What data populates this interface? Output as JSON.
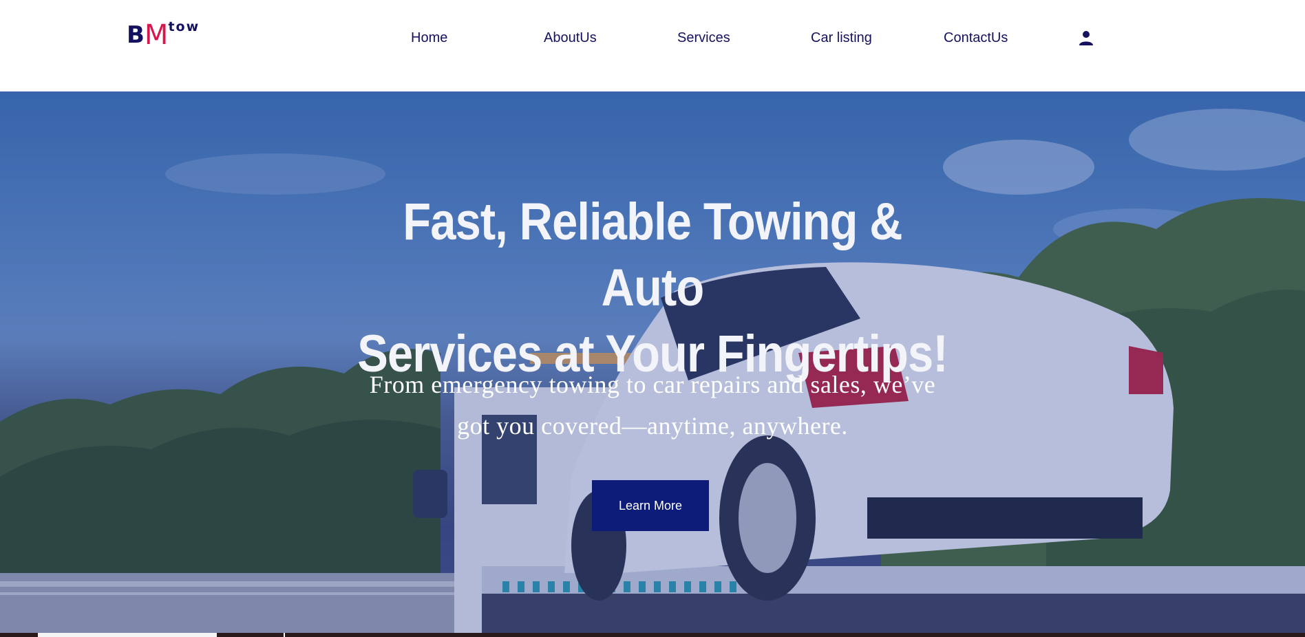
{
  "logo": {
    "letter_b": "B",
    "letter_m": "M",
    "suffix": "tow"
  },
  "nav": {
    "items": [
      {
        "label": "Home"
      },
      {
        "label": "AboutUs"
      },
      {
        "label": "Services"
      },
      {
        "label": "Car listing"
      },
      {
        "label": "ContactUs"
      }
    ],
    "account_icon": "user-icon"
  },
  "hero": {
    "title_line1": "Fast, Reliable Towing & Auto",
    "title_line2": "Services at Your Fingertips!",
    "subtitle_line1": "From emergency towing to car repairs and sales, we’ve",
    "subtitle_line2": "got you covered—anytime, anywhere.",
    "cta_label": "Learn More"
  },
  "colors": {
    "brand_navy": "#14125e",
    "brand_red": "#d7164b",
    "cta_background": "#0d1c78",
    "hero_text": "#ffffff"
  }
}
